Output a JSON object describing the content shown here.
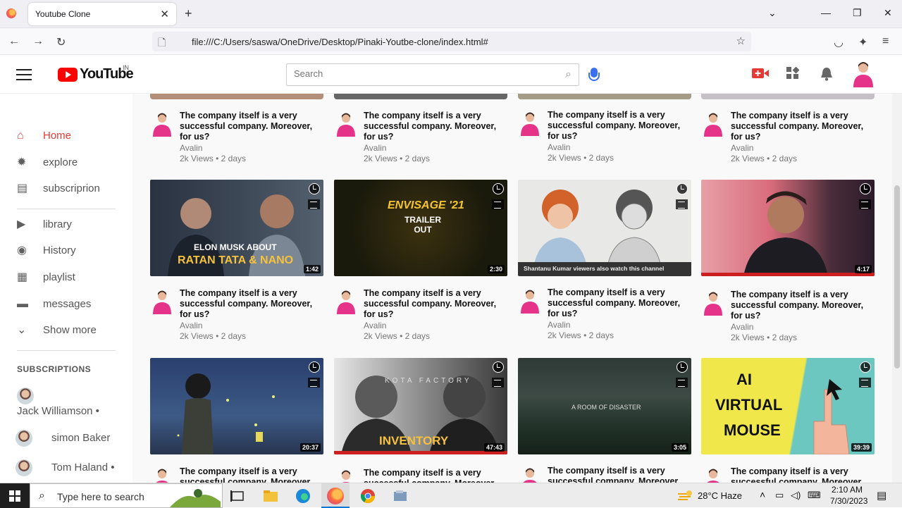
{
  "browser": {
    "tab_title": "Youtube Clone",
    "tab_close": "✕",
    "new_tab": "+",
    "url": "file:///C:/Users/saswa/OneDrive/Desktop/Pinaki-Youtbe-clone/index.html#",
    "window_controls": {
      "minimize": "—",
      "restore": "❐",
      "close": "✕",
      "list": "⌄"
    }
  },
  "header": {
    "logo_text": "YouTube",
    "region": "IN",
    "search_placeholder": "Search"
  },
  "sidebar": {
    "items": [
      {
        "label": "Home",
        "icon": "home-icon",
        "glyph": "⌂",
        "active": true
      },
      {
        "label": "explore",
        "icon": "explore-icon",
        "glyph": "✹"
      },
      {
        "label": "subscriprion",
        "icon": "subscriptions-icon",
        "glyph": "▤"
      },
      {
        "label": "library",
        "icon": "library-icon",
        "glyph": "▶"
      },
      {
        "label": "History",
        "icon": "history-icon",
        "glyph": "◉"
      },
      {
        "label": "playlist",
        "icon": "playlist-icon",
        "glyph": "▦"
      },
      {
        "label": "messages",
        "icon": "messages-icon",
        "glyph": "▬"
      },
      {
        "label": "Show more",
        "icon": "chevron-down-icon",
        "glyph": "⌄"
      }
    ],
    "subscriptions_heading": "SUBSCRIPTIONS",
    "subscriptions": [
      {
        "name": "Jack Williamson •"
      },
      {
        "name": "simon Baker"
      },
      {
        "name": "Tom Haland •"
      }
    ]
  },
  "video_common": {
    "title": "The company itself is a very successful company. Moreover, for us?",
    "channel": "Avalin",
    "meta": "2k Views • 2 days"
  },
  "videos_row2": [
    {
      "duration": "1:42",
      "overlay1": "ELON MUSK ABOUT",
      "overlay2": "RATAN TATA & NANO"
    },
    {
      "duration": "2:30",
      "overlay1": "ENVISAGE '21",
      "overlay2": "TRAILER OUT"
    },
    {
      "duration": "",
      "overlay1": "Shantanu Kumar viewers also watch this channel",
      "overlay2": ""
    },
    {
      "duration": "4:17",
      "overlay1": "",
      "overlay2": ""
    }
  ],
  "videos_row3": [
    {
      "duration": "20:37",
      "overlay1": "",
      "overlay2": ""
    },
    {
      "duration": "47:43",
      "overlay1": "KOTA FACTORY",
      "overlay2": "INVENTORY"
    },
    {
      "duration": "3:05",
      "overlay1": "A ROOM OF DISASTER",
      "overlay2": ""
    },
    {
      "duration": "39:39",
      "overlay1": "AI",
      "overlay2": "VIRTUAL",
      "overlay3": "MOUSE"
    }
  ],
  "taskbar": {
    "search_placeholder": "Type here to search",
    "weather": "28°C  Haze",
    "time": "2:10 AM",
    "date": "7/30/2023"
  },
  "colors": {
    "accent": "#e53935",
    "brand": "#ff0000",
    "search_mic": "#3a6ff0"
  }
}
